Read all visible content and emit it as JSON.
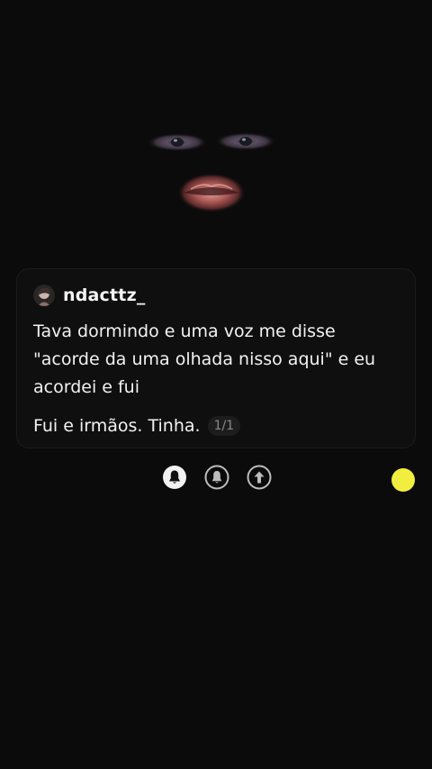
{
  "comment": {
    "username": "ndacttz_",
    "message": "Tava dormindo e uma voz me disse \"acorde da uma olhada nisso aqui\" e eu acordei e fui",
    "reply": "Fui e irmãos. Tinha.",
    "page_indicator": "1/1"
  },
  "actions": {
    "icons": [
      "bell-filled-icon",
      "bell-outline-icon",
      "arrow-up-icon"
    ]
  },
  "colors": {
    "background": "#0b0b0b",
    "card": "#0f0f0f",
    "text": "#f2f2f2",
    "muted": "#8a8a8a",
    "dot": "#f2ee3f"
  }
}
